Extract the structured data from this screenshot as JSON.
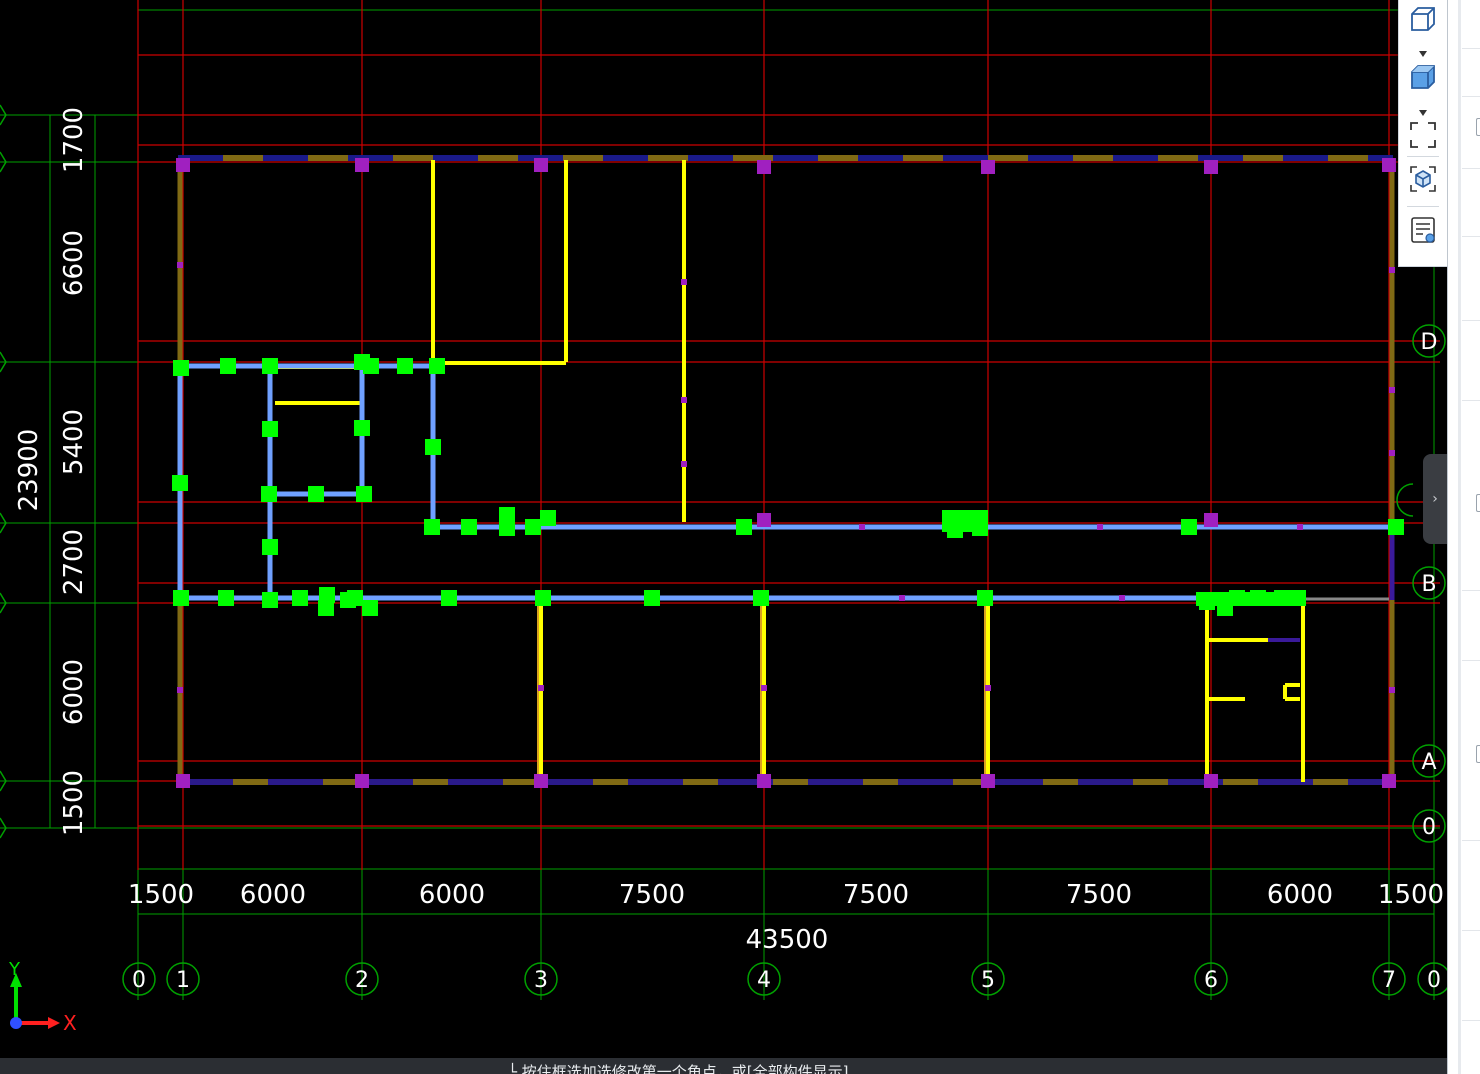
{
  "drawing": {
    "vertical_grid_bubbles": [
      "0",
      "1",
      "2",
      "3",
      "4",
      "5",
      "6",
      "7",
      "0"
    ],
    "horizontal_grid_bubbles": [
      "D",
      "B",
      "A",
      "0"
    ],
    "horizontal_dimensions": [
      "1500",
      "6000",
      "6000",
      "7500",
      "7500",
      "7500",
      "6000",
      "1500"
    ],
    "horizontal_total": "43500",
    "vertical_dimensions": [
      "1700",
      "6600",
      "5400",
      "2700",
      "6000",
      "1500"
    ],
    "vertical_total": "23900",
    "axis_gizmo": {
      "y_label": "Y",
      "x_label": "X"
    },
    "colors": {
      "grid_line": "#cc0000",
      "dimension_line": "#00a000",
      "beam_wall": "#806a14",
      "column_marker": "#a020c0",
      "partition": "#ffff00",
      "wall_blue": "#6fa0ff",
      "node": "#00ff00"
    }
  },
  "view_toolbar": {
    "buttons": [
      {
        "name": "view-cube-icon"
      },
      {
        "name": "view-cube-filled-icon"
      },
      {
        "name": "fit-view-icon"
      },
      {
        "name": "3d-box-icon"
      },
      {
        "name": "properties-list-icon"
      }
    ]
  },
  "side_panel": {
    "collapse_glyph": "›"
  },
  "status_bar": {
    "text": "└ 按住框选加选修改第一个角点，或[全部构件显示]"
  }
}
